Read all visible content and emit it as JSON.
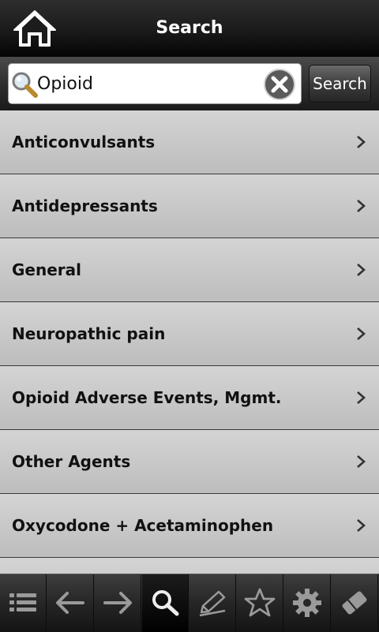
{
  "header": {
    "title": "Search",
    "home_icon": "home-icon"
  },
  "search": {
    "value": "Opioid",
    "button_label": "Search",
    "search_icon": "magnifier-icon",
    "clear_icon": "clear-icon"
  },
  "list": {
    "items": [
      {
        "label": "Anticonvulsants"
      },
      {
        "label": "Antidepressants"
      },
      {
        "label": "General"
      },
      {
        "label": "Neuropathic pain"
      },
      {
        "label": "Opioid Adverse Events, Mgmt."
      },
      {
        "label": "Other Agents"
      },
      {
        "label": "Oxycodone + Acetaminophen"
      },
      {
        "label": ""
      }
    ]
  },
  "tabbar": {
    "active": "search",
    "tabs": [
      "list-icon",
      "back-arrow-icon",
      "forward-arrow-icon",
      "search-icon",
      "edit-icon",
      "star-icon",
      "gear-icon",
      "eraser-icon"
    ]
  },
  "colors": {
    "bar_dark": "#1c1c1c",
    "row_light": "#d4d4d4",
    "icon_gray": "#9a9a9a"
  }
}
